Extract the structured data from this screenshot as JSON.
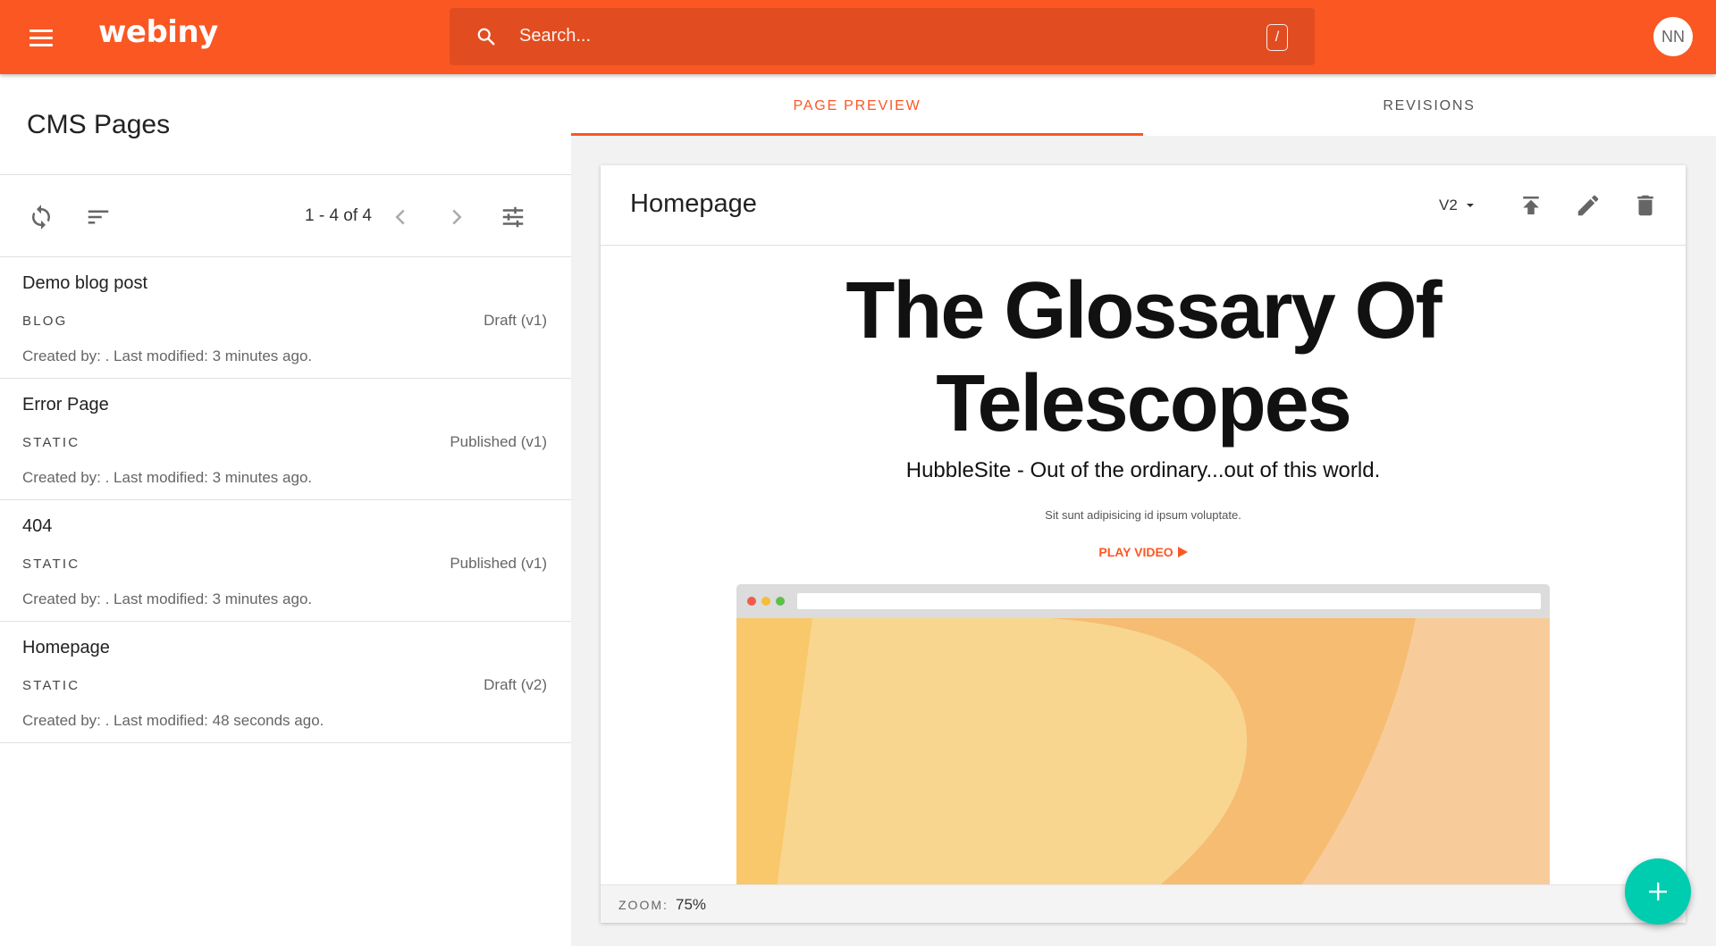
{
  "header": {
    "logo": "webiny",
    "search_placeholder": "Search...",
    "search_shortcut": "/",
    "user_initials": "NN"
  },
  "left_panel": {
    "title": "CMS Pages",
    "pagination": "1 - 4 of 4",
    "pages": [
      {
        "title": "Demo blog post",
        "category": "BLOG",
        "status": "Draft (v1)",
        "meta": "Created by: . Last modified: 3 minutes ago."
      },
      {
        "title": "Error Page",
        "category": "STATIC",
        "status": "Published (v1)",
        "meta": "Created by: . Last modified: 3 minutes ago."
      },
      {
        "title": "404",
        "category": "STATIC",
        "status": "Published (v1)",
        "meta": "Created by: . Last modified: 3 minutes ago."
      },
      {
        "title": "Homepage",
        "category": "STATIC",
        "status": "Draft (v2)",
        "meta": "Created by: . Last modified: 48 seconds ago."
      }
    ]
  },
  "tabs": [
    {
      "label": "PAGE PREVIEW",
      "active": true
    },
    {
      "label": "REVISIONS",
      "active": false
    }
  ],
  "preview": {
    "page_title": "Homepage",
    "version": "V2",
    "hero_title_line1": "The Glossary Of",
    "hero_title_line2": "Telescopes",
    "hero_subtitle": "HubbleSite - Out of the ordinary...out of this world.",
    "hero_text": "Sit sunt adipisicing id ipsum voluptate.",
    "play_video": "PLAY VIDEO",
    "zoom_label": "ZOOM:",
    "zoom_value": "75%"
  },
  "colors": {
    "brand": "#fa5723",
    "fab": "#00ccb0"
  }
}
